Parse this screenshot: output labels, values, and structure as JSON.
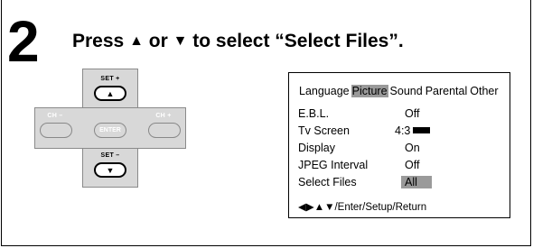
{
  "step": {
    "number": "2",
    "text_before": "Press ",
    "up_glyph": "▲",
    "text_mid": " or ",
    "down_glyph": "▼",
    "text_after": " to select “Select Files”."
  },
  "remote": {
    "set_plus_label": "SET +",
    "set_minus_label": "SET –",
    "ch_minus_label": "CH –",
    "ch_plus_label": "CH +",
    "enter_label": "ENTER",
    "up_arrow": "▲",
    "down_arrow": "▼"
  },
  "menu": {
    "tabs": [
      "Language",
      "Picture",
      "Sound",
      "Parental",
      "Other"
    ],
    "selected_tab": "Picture",
    "items": [
      {
        "label": "E.B.L.",
        "value": "Off"
      },
      {
        "label": "Tv Screen",
        "value": "4:3",
        "icon": "screen-aspect-icon"
      },
      {
        "label": "Display",
        "value": "On"
      },
      {
        "label": "JPEG Interval",
        "value": "Off"
      },
      {
        "label": "Select Files",
        "value": "All",
        "highlighted": true
      }
    ],
    "footer": "◀▶▲▼/Enter/Setup/Return"
  },
  "colors": {
    "highlight": "#9a9a9a",
    "pad_fill": "#d8d8d8"
  }
}
